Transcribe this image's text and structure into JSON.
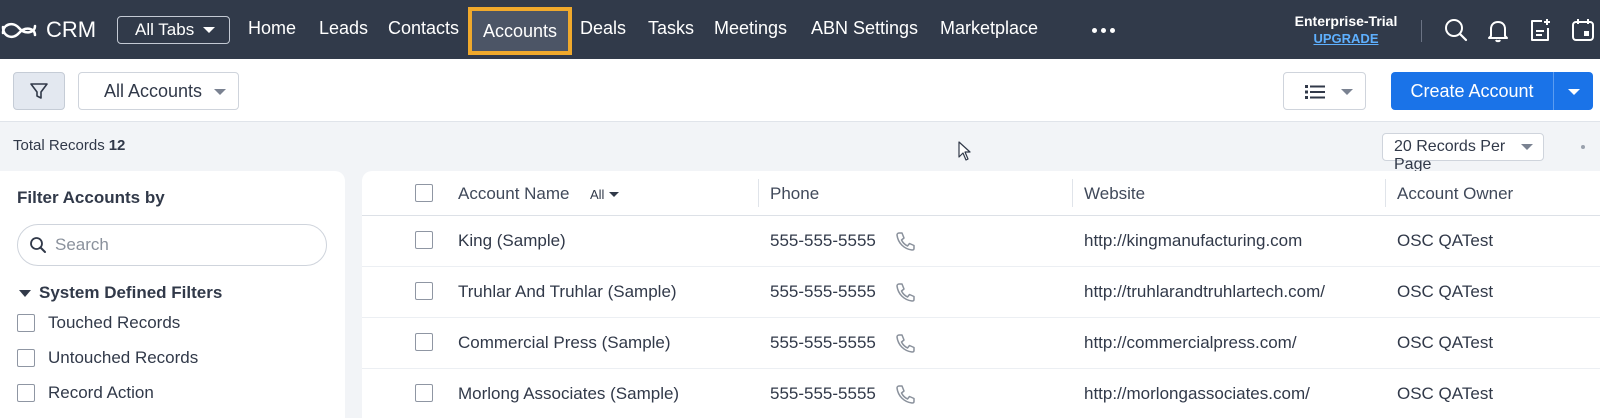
{
  "nav": {
    "logo_text": "CRM",
    "all_tabs": "All Tabs",
    "tabs": [
      "Home",
      "Leads",
      "Contacts",
      "Accounts",
      "Deals",
      "Tasks",
      "Meetings",
      "ABN Settings",
      "Marketplace"
    ],
    "active_tab": "Accounts",
    "edition": "Enterprise-Trial",
    "upgrade": "UPGRADE",
    "icons": [
      "search-icon",
      "bell-icon",
      "add-note-icon",
      "calendar-icon"
    ]
  },
  "toolbar": {
    "view": "All Accounts",
    "create_label": "Create Account",
    "primary_color": "#1a73e8"
  },
  "records": {
    "total_label": "Total Records",
    "total_count": "12",
    "per_page": "20 Records Per Page"
  },
  "filters": {
    "title": "Filter Accounts by",
    "search_placeholder": "Search",
    "section": "System Defined Filters",
    "items": [
      "Touched Records",
      "Untouched Records",
      "Record Action"
    ]
  },
  "table": {
    "columns": [
      "Account Name",
      "Phone",
      "Website",
      "Account Owner"
    ],
    "name_filter": "All",
    "rows": [
      {
        "name": "King (Sample)",
        "phone": "555-555-5555",
        "website": "http://kingmanufacturing.com",
        "owner": "OSC QATest"
      },
      {
        "name": "Truhlar And Truhlar (Sample)",
        "phone": "555-555-5555",
        "website": "http://truhlarandtruhlartech.com/",
        "owner": "OSC QATest"
      },
      {
        "name": "Commercial Press (Sample)",
        "phone": "555-555-5555",
        "website": "http://commercialpress.com/",
        "owner": "OSC QATest"
      },
      {
        "name": "Morlong Associates (Sample)",
        "phone": "555-555-5555",
        "website": "http://morlongassociates.com/",
        "owner": "OSC QATest"
      }
    ]
  }
}
